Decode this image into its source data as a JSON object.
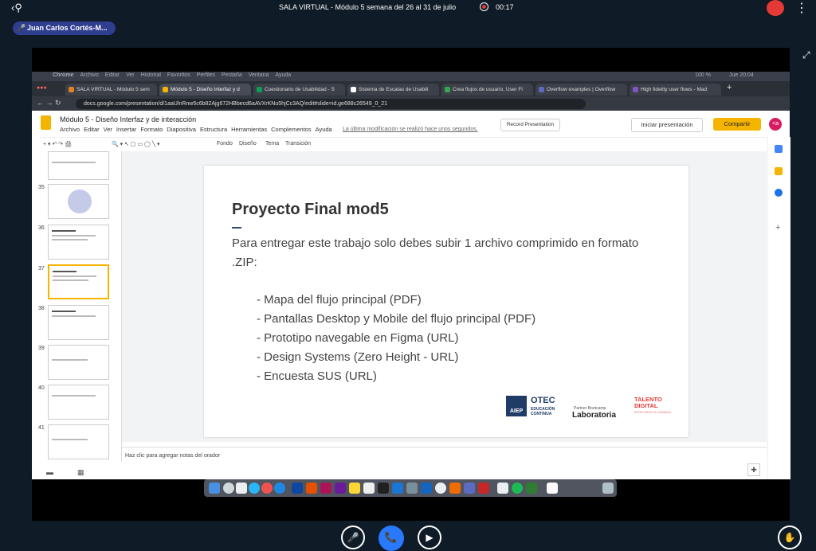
{
  "meeting": {
    "back_icon": "back-person-icon",
    "session_title": "SALA VIRTUAL - Módulo 5 semana del 26 al 31 de julio",
    "timer": "00:17",
    "speaker": "Juan Carlos Cortés-M...",
    "more_icon": "⋮",
    "expand_icon": "⤢"
  },
  "mac": {
    "menu": [
      "Chrome",
      "Archivo",
      "Editar",
      "Ver",
      "Historial",
      "Favoritos",
      "Perfiles",
      "Pestaña",
      "Ventana",
      "Ayuda"
    ],
    "status": "100 %",
    "clock": "Jue 20:04"
  },
  "browser": {
    "tabs": [
      {
        "label": "SALA VIRTUAL - Módulo 5 sem",
        "color": "#e67e22"
      },
      {
        "label": "Módulo 5 - Diseño Interfaz y d",
        "color": "#f4b400"
      },
      {
        "label": "Cuestionario de Usabilidad - S",
        "color": "#0f9d58"
      },
      {
        "label": "Sistema de Escalas de Usabili",
        "color": "#ffffff"
      },
      {
        "label": "Crea flujos de usuario, User Fl",
        "color": "#34a853"
      },
      {
        "label": "Overflow examples | Overflow",
        "color": "#5c6bc0"
      },
      {
        "label": "High fidelity user flows - Mad",
        "color": "#7e57c2"
      }
    ],
    "url": "docs.google.com/presentation/d/1aaUlnRnw5c6b82Ajg672HBbecd6aAVXrKNu5hjCc3AQ/edit#slide=id.ge688c26549_0_21"
  },
  "docs": {
    "title": "Módulo 5 - Diseño Interfaz y de interacción",
    "menus": [
      "Archivo",
      "Editar",
      "Ver",
      "Insertar",
      "Formato",
      "Diapositiva",
      "Estructura",
      "Herramientas",
      "Complementos",
      "Ayuda"
    ],
    "last_modified": "La última modificación se realizó hace unos segundos.",
    "record_label": "Record Presentation",
    "present_label": "Iniciar presentación",
    "share_label": "Compartir",
    "avatar": "<a",
    "toolbar": [
      "Fondo",
      "Diseño",
      "Tema",
      "Transición"
    ],
    "notes_placeholder": "Haz clic para agregar notas del orador"
  },
  "filmstrip": {
    "slides": [
      {
        "num": "35"
      },
      {
        "num": "36"
      },
      {
        "num": "37"
      },
      {
        "num": "38"
      },
      {
        "num": "39"
      },
      {
        "num": "40"
      },
      {
        "num": "41"
      }
    ]
  },
  "slide": {
    "title": "Proyecto Final mod5",
    "intro": "Para entregar este trabajo solo debes subir 1 archivo comprimido en formato .ZIP:",
    "items": [
      "Mapa del flujo principal (PDF)",
      "Pantallas Desktop y Mobile del flujo principal (PDF)",
      "Prototipo navegable en Figma (URL)",
      "Design Systems (Zero Height - URL)",
      "Encuesta SUS (URL)"
    ],
    "logo_otec": "OTEC",
    "logo_otec_sub": "EDUCACIÓN CONTINUA",
    "logo_aiep": "AIEP",
    "logo_lab_small": "Partner Bootcamp",
    "logo_lab": "Laboratoria",
    "logo_talent": "TALENTO DIGITAL",
    "logo_talent_sub": "INTELIGENCIA HUMANA"
  }
}
